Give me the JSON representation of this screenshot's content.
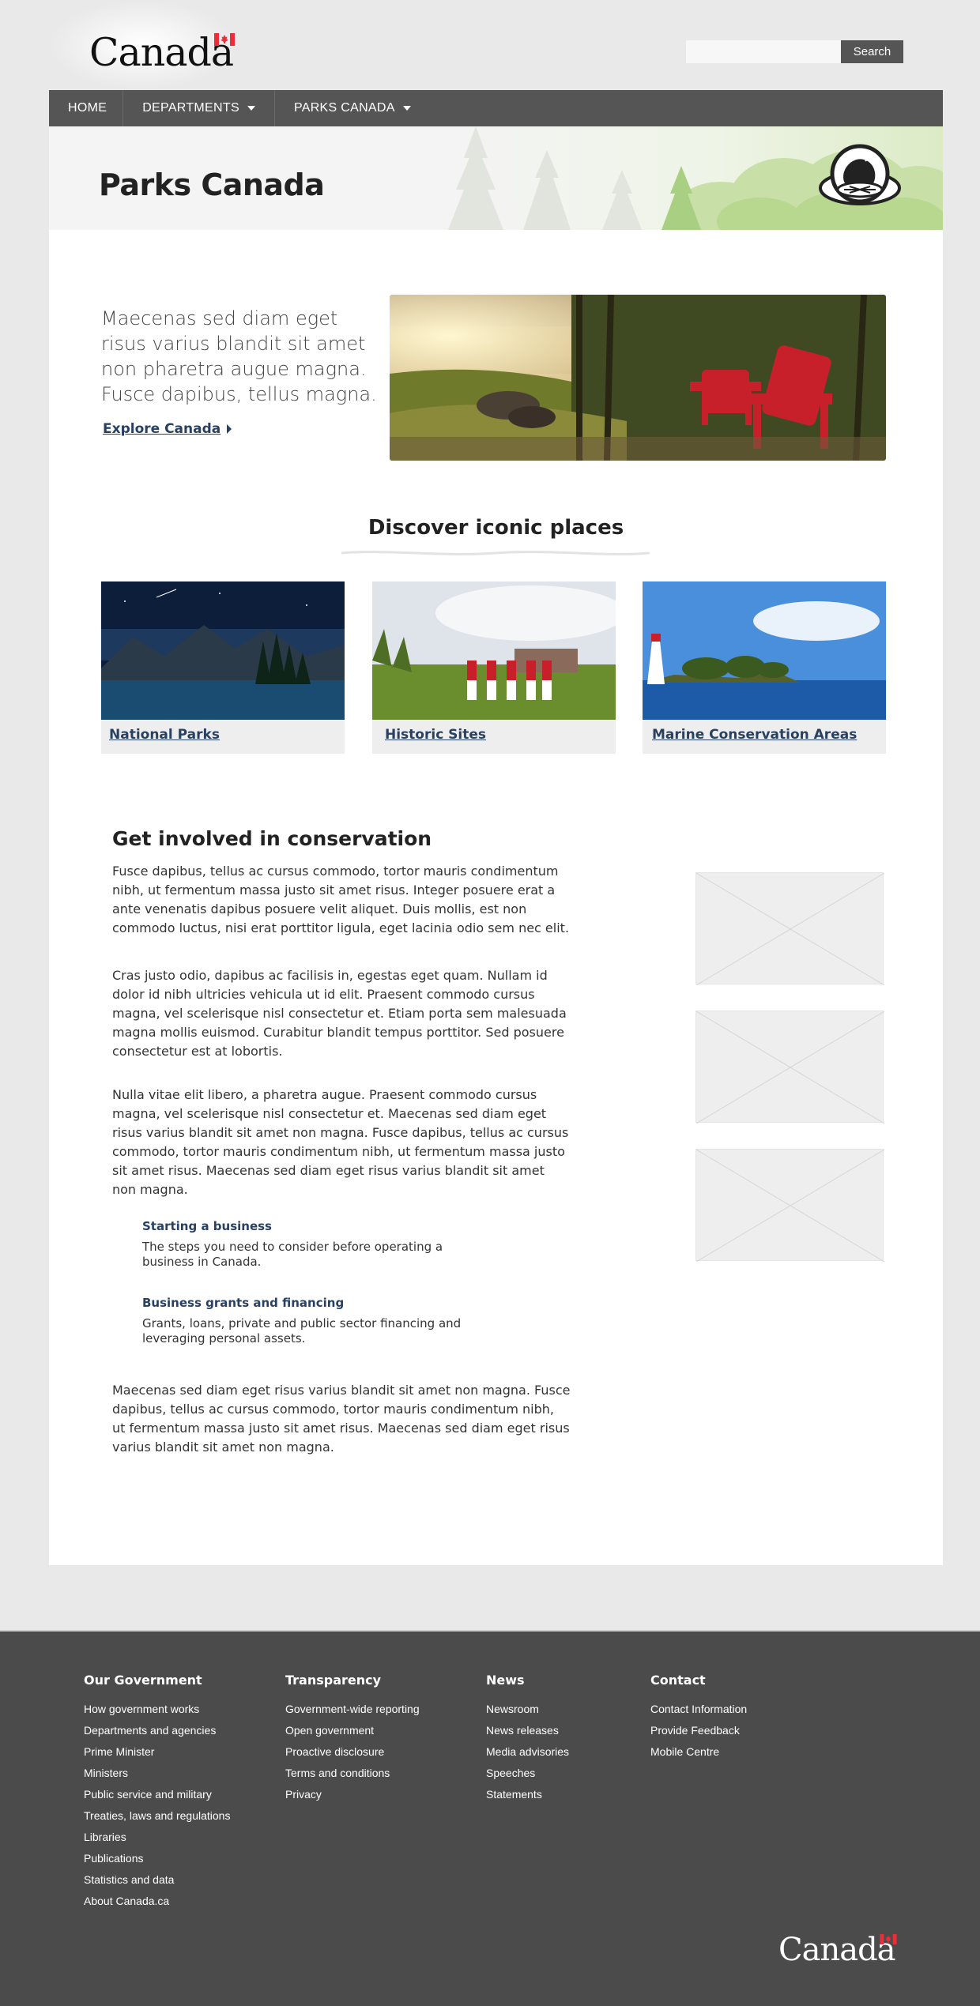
{
  "header": {
    "wordmark": "Canada",
    "search_placeholder": "",
    "search_button": "Search"
  },
  "nav": {
    "items": [
      {
        "label": "HOME"
      },
      {
        "label": "DEPARTMENTS"
      },
      {
        "label": "PARKS CANADA"
      }
    ]
  },
  "banner": {
    "title": "Parks Canada"
  },
  "intro": {
    "text": "Maecenas sed diam eget risus varius blandit sit amet non pharetra augue magna. Fusce dapibus, tellus magna.",
    "link": "Explore Canada"
  },
  "discover": {
    "title": "Discover iconic places",
    "cards": [
      {
        "label": "National Parks"
      },
      {
        "label": "Historic Sites"
      },
      {
        "label": "Marine Conservation Areas"
      }
    ]
  },
  "conservation": {
    "title": "Get involved in conservation",
    "paragraphs": [
      "Fusce dapibus, tellus ac cursus commodo, tortor mauris condimentum nibh, ut fermentum massa justo sit amet risus. Integer posuere erat a ante venenatis dapibus posuere velit aliquet. Duis mollis, est non commodo luctus, nisi erat porttitor ligula, eget lacinia odio sem nec elit.",
      "Cras justo odio, dapibus ac facilisis in, egestas eget quam. Nullam id dolor id nibh ultricies vehicula ut id elit. Praesent commodo cursus magna, vel scelerisque nisl consectetur et. Etiam porta sem malesuada magna mollis euismod. Curabitur blandit tempus porttitor. Sed posuere consectetur est at lobortis.",
      "Nulla vitae elit libero, a pharetra augue. Praesent commodo cursus magna, vel scelerisque nisl consectetur et. Maecenas sed diam eget risus varius blandit sit amet non magna. Fusce dapibus, tellus ac cursus commodo, tortor mauris condimentum nibh, ut fermentum massa justo sit amet risus. Maecenas sed diam eget risus varius blandit sit amet non magna.",
      "Maecenas sed diam eget risus varius blandit sit amet non magna. Fusce dapibus, tellus ac cursus commodo, tortor mauris condimentum nibh, ut fermentum massa justo sit amet risus. Maecenas sed diam eget risus varius blandit sit amet non magna."
    ],
    "resources": [
      {
        "title": "Starting a business",
        "desc": "The steps you need to consider before operating a business in Canada."
      },
      {
        "title": "Business grants and financing",
        "desc": "Grants, loans, private and public sector financing and leveraging personal assets."
      }
    ]
  },
  "footer": {
    "columns": [
      {
        "title": "Our Government",
        "links": [
          "How government works",
          "Departments and agencies",
          "Prime Minister",
          "Ministers",
          "Public service and military",
          "Treaties, laws and regulations",
          "Libraries",
          "Publications",
          "Statistics and data",
          "About Canada.ca"
        ]
      },
      {
        "title": "Transparency",
        "links": [
          "Government-wide reporting",
          "Open government",
          "Proactive disclosure",
          "Terms and conditions",
          "Privacy"
        ]
      },
      {
        "title": "News",
        "links": [
          "Newsroom",
          "News releases",
          "Media advisories",
          "Speeches",
          "Statements"
        ]
      },
      {
        "title": "Contact",
        "links": [
          "Contact Information",
          "Provide Feedback",
          "Mobile Centre"
        ]
      }
    ],
    "wordmark": "Canada"
  },
  "colors": {
    "link": "#284162",
    "nav": "#555555",
    "footer": "#4b4b4b",
    "flag_red": "#eb2d37"
  }
}
